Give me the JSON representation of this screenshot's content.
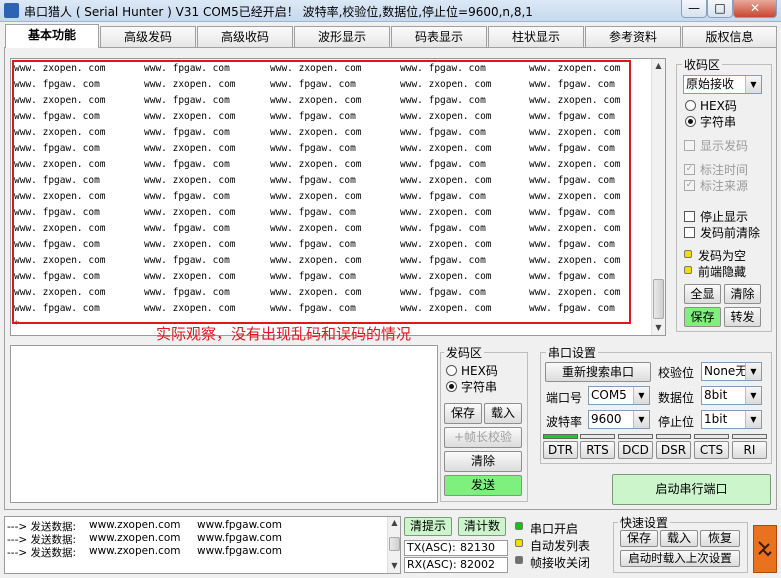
{
  "window": {
    "title": "串口猎人 ( Serial Hunter ) V31     COM5已经开启！ 波特率,校验位,数据位,停止位=9600,n,8,1",
    "buttons": {
      "minimize": "—",
      "maximize": "□",
      "close": "✕"
    }
  },
  "tabs": [
    "基本功能",
    "高级发码",
    "高级收码",
    "波形显示",
    "码表显示",
    "柱状显示",
    "参考资料",
    "版权信息"
  ],
  "receive": {
    "columns": [
      [
        "www.zxopen.com",
        "www.fpgaw.com",
        "www.zxopen.com",
        "www.fpgaw.com",
        "www.zxopen.com"
      ],
      [
        "www.fpgaw.com",
        "www.zxopen.com",
        "www.fpgaw.com",
        "www.zxopen.com",
        "www.fpgaw.com"
      ]
    ],
    "caret": "*",
    "annotation": "实际观察，没有出现乱码和误码的情况"
  },
  "recv_panel": {
    "title": "收码区",
    "mode_select": "原始接收",
    "radio_hex": "HEX码",
    "radio_str": "字符串",
    "show_send": "显示发码",
    "mark_time": "标注时间",
    "mark_source": "标注来源",
    "stop_display": "停止显示",
    "clear_before_send": "发码前清除",
    "send_empty": "发码为空",
    "hide_prefix": "前端隐藏",
    "btn_full": "全显",
    "btn_clear": "清除",
    "btn_save": "保存",
    "btn_convert": "转发"
  },
  "send_panel": {
    "title": "发码区",
    "radio_hex": "HEX码",
    "radio_str": "字符串",
    "btn_save": "保存",
    "btn_load": "载入",
    "btn_checksum": "+帧长校验",
    "btn_clear": "清除",
    "btn_send": "发送"
  },
  "port_settings": {
    "title": "串口设置",
    "btn_rescan": "重新搜索串口",
    "parity_label": "校验位",
    "parity_value": "None无",
    "port_label": "端口号",
    "port_value": "COM5",
    "databits_label": "数据位",
    "databits_value": "8bit",
    "baud_label": "波特率",
    "baud_value": "9600",
    "stopbits_label": "停止位",
    "stopbits_value": "1bit",
    "signals": [
      "DTR",
      "RTS",
      "DCD",
      "DSR",
      "CTS",
      "RI"
    ],
    "btn_start": "启动串行端口"
  },
  "log": {
    "rows": [
      [
        "---> 发送数据:",
        "www.zxopen.com",
        "www.fpgaw.com"
      ],
      [
        "---> 发送数据:",
        "www.zxopen.com",
        "www.fpgaw.com"
      ],
      [
        "---> 发送数据:",
        "www.zxopen.com",
        "www.fpgaw.com"
      ]
    ]
  },
  "bottom": {
    "btn_clear_hint": "清提示",
    "btn_clear_count": "清计数",
    "tx_label": "TX(ASC):",
    "tx_value": "82130",
    "rx_label": "RX(ASC):",
    "rx_value": "82002",
    "status_open": "串口开启",
    "status_auto_send": "自动发列表",
    "status_frame": "帧接收关闭",
    "quick_title": "快速设置",
    "btn_save": "保存",
    "btn_load": "载入",
    "btn_restore": "恢复",
    "btn_load_last": "启动时载入上次设置"
  },
  "colors": {
    "highlight_red": "#e0161b",
    "led_green": "#22c922",
    "send_green": "#7df07d",
    "status_green": "#17c217",
    "status_yellow": "#f0e000",
    "brand_orange": "#e8721e"
  }
}
